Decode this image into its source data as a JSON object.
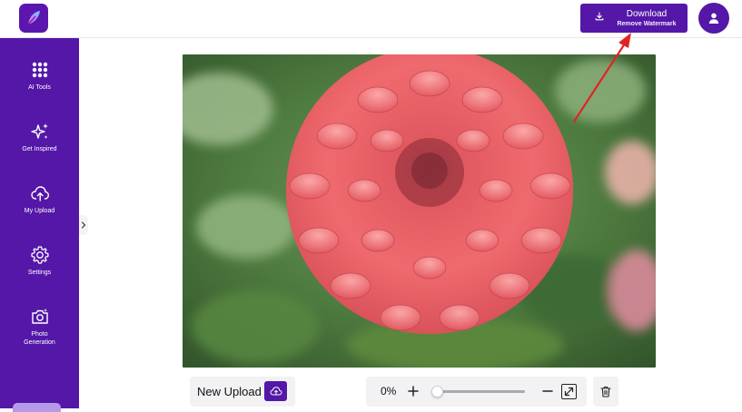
{
  "header": {
    "download_label": "Download",
    "download_sublabel": "Remove Watermark"
  },
  "sidebar": {
    "items": [
      {
        "label": "AI Tools",
        "icon": "grid-icon"
      },
      {
        "label": "Get Inspired",
        "icon": "sparkles-icon"
      },
      {
        "label": "My Upload",
        "icon": "cloud-upload-icon"
      },
      {
        "label": "Settings",
        "icon": "gear-icon"
      },
      {
        "label": "Photo\nGeneration",
        "icon": "camera-icon"
      }
    ]
  },
  "toolbar": {
    "new_upload_label": "New Upload",
    "zoom_percent": "0%",
    "zoom_value": 0
  },
  "canvas": {
    "subject": "pink dahlia flower photo"
  },
  "colors": {
    "brand": "#5417a8",
    "annotation_arrow": "#e02424"
  }
}
